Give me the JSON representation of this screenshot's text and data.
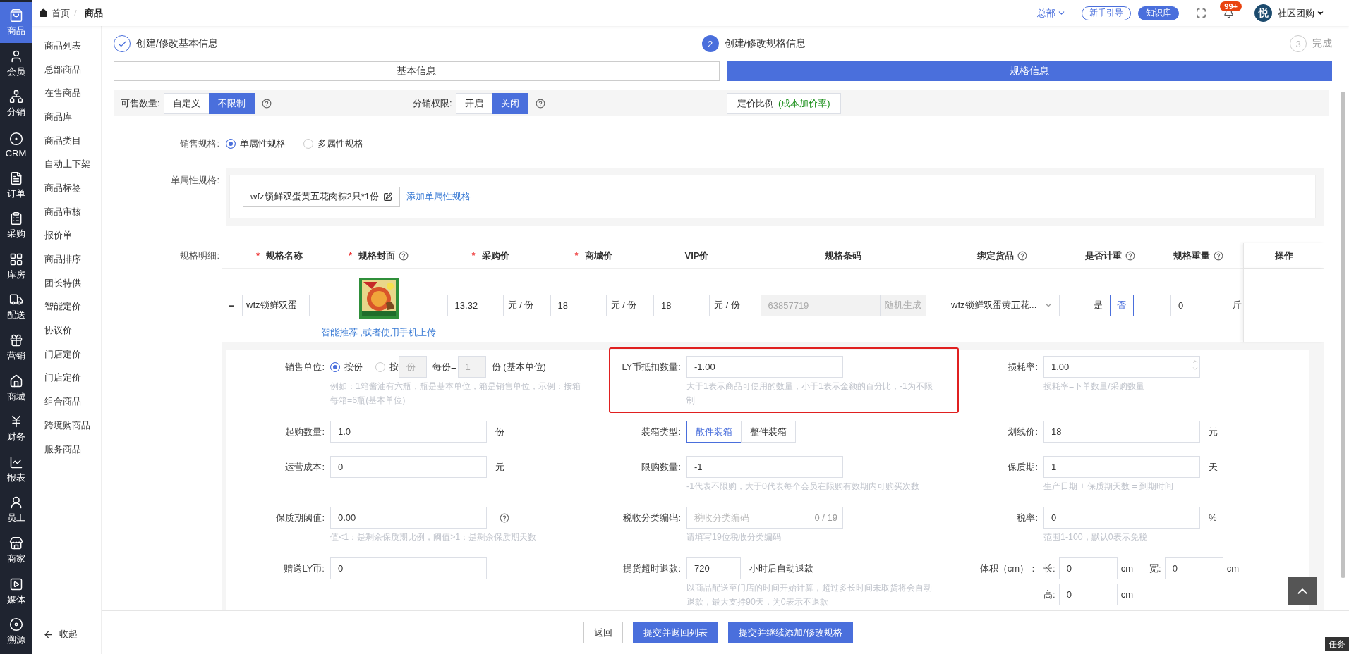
{
  "header": {
    "breadcrumb": [
      {
        "label": "首页"
      },
      {
        "label": "商品"
      }
    ],
    "separator": "/",
    "org": "总部",
    "guide": "新手引导",
    "knowledge": "知识库",
    "badge": "99+",
    "avatar": "悦",
    "user": "社区团购"
  },
  "rail": [
    {
      "label": "商品",
      "selected": true
    },
    {
      "label": "会员",
      "selected": false
    },
    {
      "label": "分销",
      "selected": false
    },
    {
      "label": "CRM",
      "selected": false
    },
    {
      "label": "订单",
      "selected": false
    },
    {
      "label": "采购",
      "selected": false
    },
    {
      "label": "库房",
      "selected": false
    },
    {
      "label": "配送",
      "selected": false
    },
    {
      "label": "营销",
      "selected": false
    },
    {
      "label": "商城",
      "selected": false
    },
    {
      "label": "财务",
      "selected": false
    },
    {
      "label": "报表",
      "selected": false
    },
    {
      "label": "员工",
      "selected": false
    },
    {
      "label": "商家",
      "selected": false
    },
    {
      "label": "媒体",
      "selected": false
    },
    {
      "label": "溯源",
      "selected": false
    }
  ],
  "submenu": {
    "items": [
      "商品列表",
      "总部商品",
      "在售商品",
      "商品库",
      "商品类目",
      "自动上下架",
      "商品标签",
      "商品审核",
      "报价单",
      "商品排序",
      "团长特供",
      "智能定价",
      "协议价",
      "门店定价",
      "门店定价",
      "组合商品",
      "跨境购商品",
      "服务商品"
    ],
    "collapse": "收起"
  },
  "steps": [
    {
      "title": "创建/修改基本信息",
      "completed": true,
      "current": false
    },
    {
      "number": "2",
      "title": "创建/修改规格信息",
      "completed": false,
      "current": true
    },
    {
      "number": "3",
      "title": "完成",
      "completed": false,
      "current": false
    }
  ],
  "tabs": [
    {
      "label": "基本信息",
      "selected": false
    },
    {
      "label": "规格信息",
      "selected": true
    }
  ],
  "toolbar": {
    "groups": [
      {
        "label": "可售数量:",
        "options": [
          {
            "label": "自定义",
            "selected": false
          },
          {
            "label": "不限制",
            "selected": true
          }
        ]
      },
      {
        "label": "分销权限:",
        "options": [
          {
            "label": "开启",
            "selected": false
          },
          {
            "label": "关闭",
            "selected": true
          }
        ]
      }
    ],
    "pricing": {
      "label": "定价比例",
      "note": "(成本加价率)"
    }
  },
  "sale_spec": {
    "label": "销售规格:",
    "options": [
      {
        "label": "单属性规格",
        "selected": true
      },
      {
        "label": "多属性规格",
        "selected": false
      }
    ]
  },
  "single_spec": {
    "label": "单属性规格:",
    "chip": "wfz锁鲜双蛋黄五花肉粽2只*1份",
    "add_link": "添加单属性规格"
  },
  "spec_table": {
    "label": "规格明细:",
    "columns": [
      {
        "label": "规格名称",
        "mark": "*",
        "help": false
      },
      {
        "label": "规格封面",
        "mark": "*",
        "help": true
      },
      {
        "label": "采购价",
        "mark": "*",
        "help": false
      },
      {
        "label": "商城价",
        "mark": "*",
        "help": false
      },
      {
        "label": "VIP价",
        "help": false
      },
      {
        "label": "规格条码",
        "help": false
      },
      {
        "label": "绑定货品",
        "help": true
      },
      {
        "label": "是否计重",
        "help": true
      },
      {
        "label": "规格重量",
        "help": true
      },
      {
        "label": "操作",
        "help": false
      }
    ],
    "rows": [
      {
        "expand": "−",
        "name": "wfz锁鲜双蛋",
        "cover_link": "智能推荐 ,或者使用手机上传",
        "purchase": "13.32",
        "purchase_unit": "元 / 份",
        "mall": "18",
        "mall_unit": "元 / 份",
        "vip": "18",
        "vip_unit": "元 / 份",
        "barcode": "63857719",
        "barcode_button": "随机生成",
        "bound": "wfz锁鲜双蛋黄五花...",
        "weigh": [
          {
            "label": "是",
            "selected": false
          },
          {
            "label": "否",
            "selected": true
          }
        ],
        "weight": "0",
        "weight_unit": "斤"
      }
    ]
  },
  "detail": {
    "fields": [
      {
        "kind": "unit",
        "label": "销售单位:",
        "options": [
          {
            "label": "按份",
            "selected": true
          },
          {
            "label": "按",
            "selected": false
          }
        ],
        "unit_value": "份",
        "per_label": "每份=",
        "per_value": "1",
        "base_unit": "份 (基本单位)",
        "hint": "例如：1箱酱油有六瓶，瓶是基本单位，箱是销售单位，示例：按箱每箱=6瓶(基本单位)"
      },
      {
        "kind": "input",
        "label": "LY币抵扣数量:",
        "value": "-1.00",
        "hint": "大于1表示商品可使用的数量，小于1表示金额的百分比，-1为不限制",
        "highlighted": true
      },
      {
        "kind": "input",
        "label": "损耗率:",
        "value": "1.00",
        "spinner": true,
        "hint": "损耗率=下单数量/采购数量"
      },
      {
        "kind": "input",
        "label": "起购数量:",
        "value": "1.0",
        "suffix": "份"
      },
      {
        "kind": "segmented",
        "label": "装箱类型:",
        "options": [
          {
            "label": "散件装箱",
            "selected": true
          },
          {
            "label": "整件装箱",
            "selected": false
          }
        ]
      },
      {
        "kind": "input",
        "label": "划线价:",
        "value": "18",
        "suffix": "元"
      },
      {
        "kind": "input",
        "label": "运营成本:",
        "value": "0",
        "suffix": "元"
      },
      {
        "kind": "input",
        "label": "限购数量:",
        "value": "-1",
        "hint": "-1代表不限购，大于0代表每个会员在限购有效期内可购买次数"
      },
      {
        "kind": "input",
        "label": "保质期:",
        "value": "1",
        "suffix": "天",
        "hint": "生产日期 + 保质期天数 = 到期时间"
      },
      {
        "kind": "input",
        "label": "保质期阈值:",
        "value": "0.00",
        "help": true,
        "hint": "值<1：是剩余保质期比例，阈值>1：是剩余保质期天数"
      },
      {
        "kind": "input",
        "label": "税收分类编码:",
        "placeholder": "税收分类编码",
        "counter": "0 / 19",
        "hint": "请填写19位税收分类编码"
      },
      {
        "kind": "input",
        "label": "税率:",
        "value": "0",
        "suffix": "%",
        "hint": "范围1-100，默认0表示免税"
      },
      {
        "kind": "input",
        "label": "赠送LY币:",
        "value": "0"
      },
      {
        "kind": "short_input",
        "label": "提货超时退款:",
        "value": "720",
        "suffix": "小时后自动退款",
        "hint": "以商品配送至门店的时间开始计算，超过多长时间未取货将会自动退款，最大支持90天，为0表示不退款"
      },
      {
        "kind": "volume",
        "label": "体积（cm）：",
        "parts": [
          {
            "label": "长:",
            "value": "0",
            "unit": "cm"
          },
          {
            "label": "宽:",
            "value": "0",
            "unit": "cm"
          },
          {
            "label": "高:",
            "value": "0",
            "unit": "cm"
          }
        ]
      }
    ]
  },
  "footer": {
    "buttons": [
      {
        "label": "返回",
        "kind": "default"
      },
      {
        "label": "提交并返回列表",
        "kind": "primary"
      },
      {
        "label": "提交并继续添加/修改规格",
        "kind": "primary"
      }
    ]
  },
  "task_tab": "任务"
}
